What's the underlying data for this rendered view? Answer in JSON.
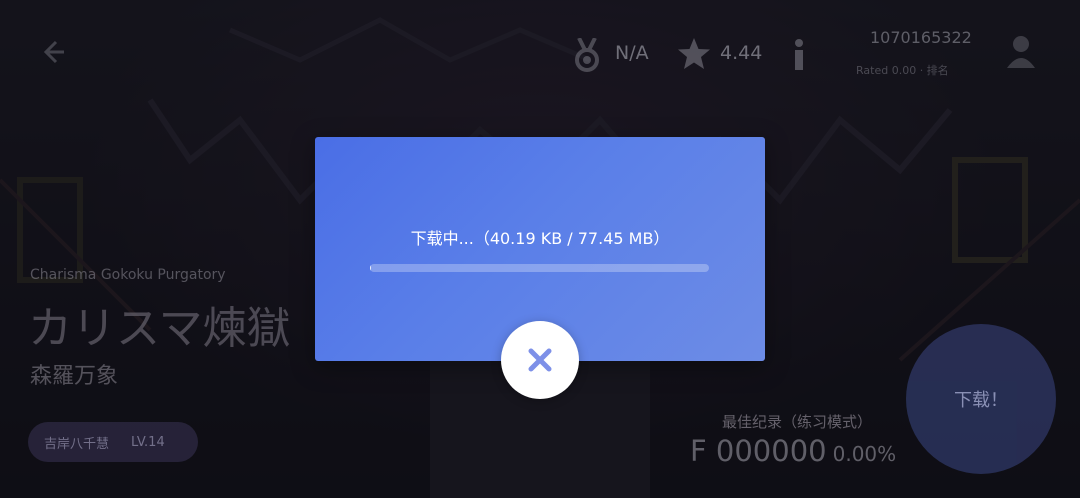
{
  "header": {
    "rank_value": "N/A",
    "rating_value": "4.44",
    "user_id": "1070165322",
    "user_sub": "Rated 0.00 · 排名"
  },
  "song": {
    "subtitle": "Charisma Gokoku Purgatory",
    "title": "カリスマ煉獄",
    "artist": "森羅万象",
    "charter": "吉岸八千慧",
    "level": "LV.14"
  },
  "best_record": {
    "label": "最佳纪录（练习模式）",
    "grade_score": "F 000000",
    "accuracy": "0.00%"
  },
  "bg_download_label": "下载！",
  "dialog": {
    "status_text": "下载中...（40.19 KB / 77.45 MB）",
    "progress_fraction": 0.0005
  },
  "icons": {
    "back": "back-arrow-icon",
    "medal": "medal-icon",
    "star": "star-icon",
    "info": "info-icon",
    "avatar": "avatar-icon",
    "close": "close-icon"
  },
  "colors": {
    "dialog_start": "#4a6ee6",
    "dialog_end": "#6d8ce6",
    "close_icon": "#7d90e8"
  }
}
